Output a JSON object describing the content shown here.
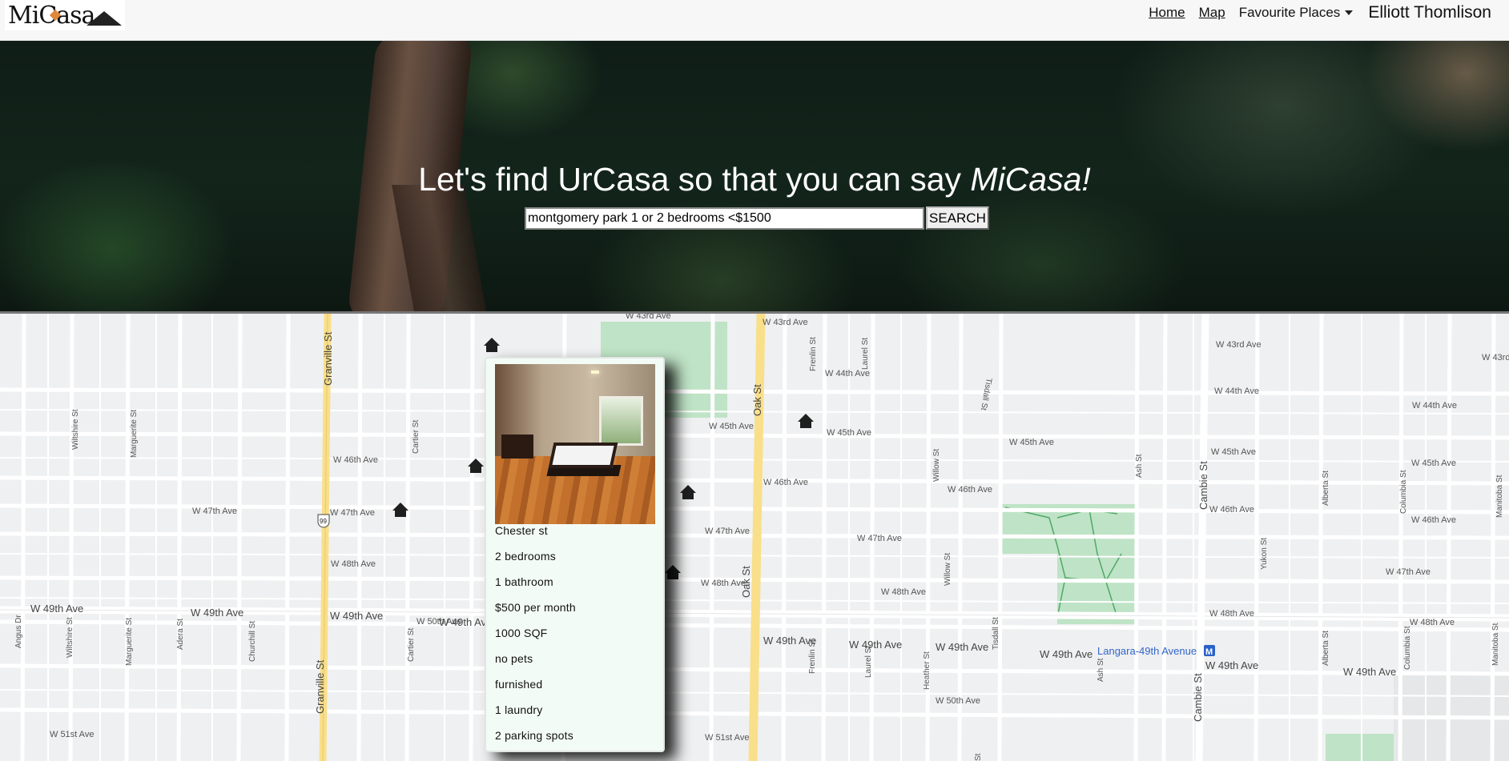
{
  "app": {
    "logo_text": "MiCasa"
  },
  "nav": {
    "home": "Home",
    "map": "Map",
    "favourites": "Favourite Places",
    "user": "Elliott Thomlison"
  },
  "hero": {
    "title_plain": "Let's find UrCasa so that you can say ",
    "title_em": "MiCasa!",
    "search_value": "montgomery park 1 or 2 bedrooms <$1500",
    "search_button": "SEARCH"
  },
  "map": {
    "streets": [
      "W 43rd Ave",
      "W 44th Ave",
      "W 45th Ave",
      "W 46th Ave",
      "W 47th Ave",
      "W 48th Ave",
      "W 49th Ave",
      "W 50th Ave",
      "W 51st Ave",
      "Granville St",
      "Oak St",
      "Cambie St",
      "Tisdall St",
      "Laurel St",
      "Frenlin St",
      "Willow St",
      "Ash St",
      "Heather St",
      "Wiltshire St",
      "Marguerite St",
      "Cartier St",
      "Adera St",
      "Churchill St",
      "Angus Dr",
      "Alberta St",
      "Columbia St",
      "Manitoba St",
      "Yukon St"
    ],
    "station": "Langara-49th Avenue",
    "route_shield": "99",
    "marker_icon": "house-icon"
  },
  "listing": {
    "street": "Chester st",
    "bedrooms": "2 bedrooms",
    "bathrooms": "1 bathroom",
    "price": "$500 per month",
    "size": "1000 SQF",
    "pets": "no pets",
    "furnished": "furnished",
    "laundry": "1 laundry",
    "parking": "2 parking spots"
  }
}
